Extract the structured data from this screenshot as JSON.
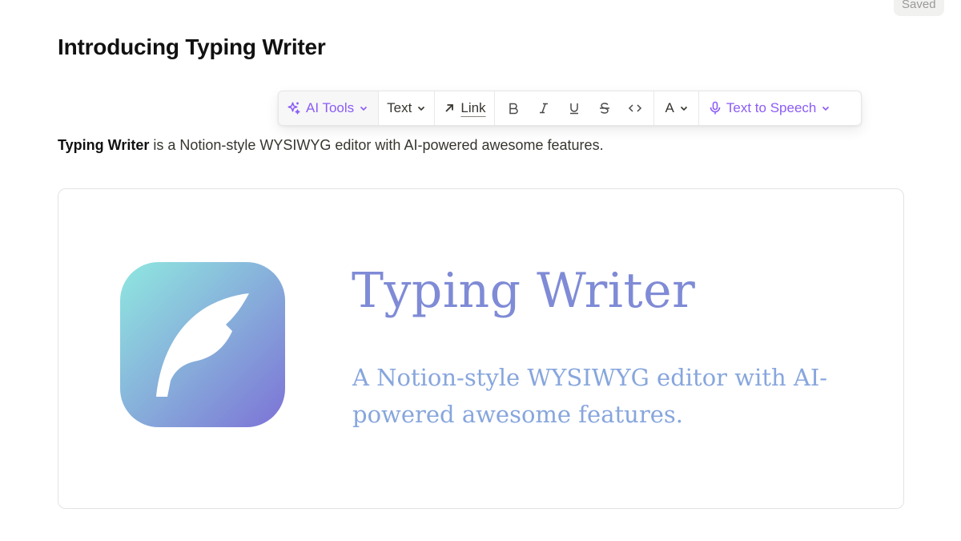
{
  "status": {
    "saved_label": "Saved"
  },
  "document": {
    "title": "Introducing Typing Writer",
    "intro_bold": "Typing Writer",
    "intro_rest": " is a Notion-style WYSIWYG editor with AI-powered awesome features."
  },
  "toolbar": {
    "ai_tools": {
      "label": "AI Tools",
      "icon": "sparkles-icon"
    },
    "text_type": {
      "label": "Text"
    },
    "link": {
      "label": "Link",
      "icon": "arrow-up-right-icon"
    },
    "format": [
      {
        "name": "bold",
        "icon": "bold-icon"
      },
      {
        "name": "italic",
        "icon": "italic-icon"
      },
      {
        "name": "underline",
        "icon": "underline-icon"
      },
      {
        "name": "strikethrough",
        "icon": "strikethrough-icon"
      },
      {
        "name": "code",
        "icon": "code-icon"
      }
    ],
    "text_color": {
      "label": "A"
    },
    "text_to_speech": {
      "label": "Text to Speech",
      "icon": "microphone-icon"
    },
    "accent_color": "#8b5cf6"
  },
  "banner": {
    "title": "Typing Writer",
    "subtitle": "A Notion-style WYSIWYG editor with AI-powered awesome features.",
    "logo": "feather-quill-icon",
    "title_color": "#7f8bd6",
    "subtitle_color": "#87a6dd"
  }
}
